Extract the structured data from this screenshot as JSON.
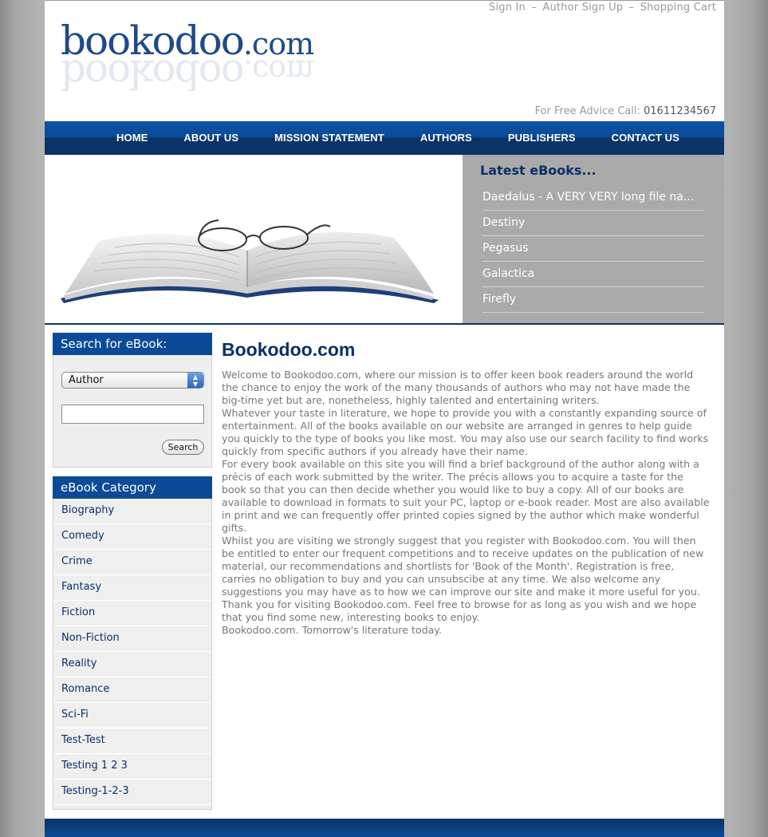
{
  "header": {
    "top_links": {
      "sign_in": "Sign In",
      "author_sign_up": "Author Sign Up",
      "shopping_cart": "Shopping Cart",
      "separator": "–"
    },
    "logo": {
      "name": "bookodoo",
      "tld": ".com"
    },
    "advice_label": "For Free Advice Call:",
    "advice_number": "01611234567"
  },
  "nav": {
    "items": [
      "HOME",
      "ABOUT US",
      "MISSION STATEMENT",
      "AUTHORS",
      "PUBLISHERS",
      "CONTACT US"
    ]
  },
  "latest": {
    "title": "Latest eBooks...",
    "items": [
      "Daedalus - A VERY VERY long file na...",
      "Destiny",
      "Pegasus",
      "Galactica",
      "Firefly"
    ]
  },
  "search": {
    "title": "Search for eBook:",
    "select_value": "Author",
    "input_value": "",
    "button_label": "Search"
  },
  "categories": {
    "title": "eBook Category",
    "items": [
      "Biography",
      "Comedy",
      "Crime",
      "Fantasy",
      "Fiction",
      "Non-Fiction",
      "Reality",
      "Romance",
      "Sci-Fi",
      "Test-Test",
      "Testing 1 2 3",
      "Testing-1-2-3"
    ]
  },
  "main": {
    "title": "Bookodoo.com",
    "paragraphs": [
      "Welcome to Bookodoo.com, where our mission is to offer keen book readers around the world the chance to enjoy the work of the many thousands of authors who may not have made the big-time yet but are, nonetheless, highly talented and entertaining writers.",
      "Whatever your taste in literature, we hope to provide you with a constantly expanding source of entertainment. All of the books available on our website are arranged in genres to help guide you quickly to the type of books you like most. You may also use our search facility to find works quickly from specific authors if you already have their name.",
      "For every book available on this site you will find a brief background of the author along with a précis of each work submitted by the writer. The précis allows you to acquire a taste for the book so that you can then decide whether you would like to buy a copy. All of our books are available to download in formats to suit your PC, laptop or e-book reader. Most are also available in print and we can frequently offer printed copies signed by the author which make wonderful gifts.",
      "Whilst you are visiting we strongly suggest that you register with Bookodoo.com. You will then be entitled to enter our frequent competitions and to receive updates on the publication of new material, our recommendations and shortlists for 'Book of the Month'. Registration is free, carries no obligation to buy and you can unsubscibe at any time. We also welcome any suggestions you may have as to how we can improve our site and make it more useful for you.",
      "Thank you for visiting Bookodoo.com. Feel free to browse for as long as you wish and we hope that you find some new, interesting books to enjoy.",
      "Bookodoo.com. Tomorrow's literature today."
    ]
  },
  "colors": {
    "brand_blue": "#0b4a97",
    "dark_navy": "#0a2f66",
    "latest_bg": "#aaaaaa",
    "body_text": "#777777"
  }
}
